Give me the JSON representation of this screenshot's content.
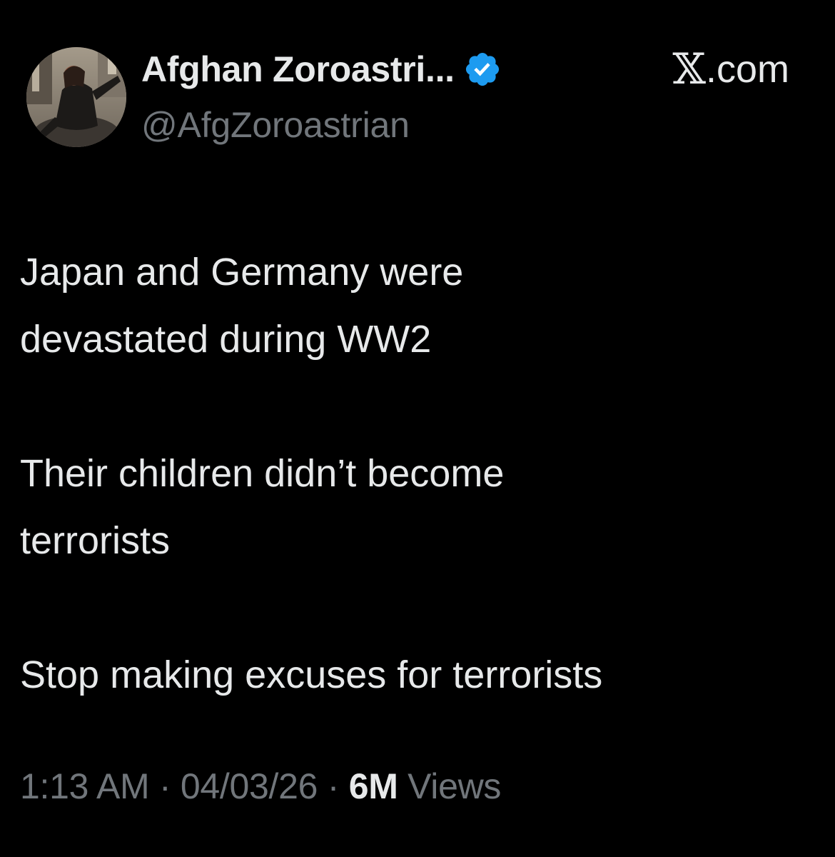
{
  "author": {
    "display_name": "Afghan Zoroastri...",
    "handle": "@AfgZoroastrian",
    "verified": true,
    "verified_color": "#1d9bf0",
    "avatar_icon": "profile-photo"
  },
  "site": {
    "logo_glyph": "𝕏",
    "domain_suffix": ".com"
  },
  "tweet": {
    "lines": [
      "Japan and Germany were",
      "devastated during WW2",
      "",
      "Their children didn’t become",
      "terrorists",
      "",
      "Stop making excuses for terrorists"
    ]
  },
  "meta": {
    "time": "1:13 AM",
    "separator": " · ",
    "date": "04/03/26",
    "views_count": "6M",
    "views_label": " Views"
  },
  "colors": {
    "background": "#000000",
    "text_primary": "#e7e9ea",
    "text_secondary": "#71767b"
  }
}
